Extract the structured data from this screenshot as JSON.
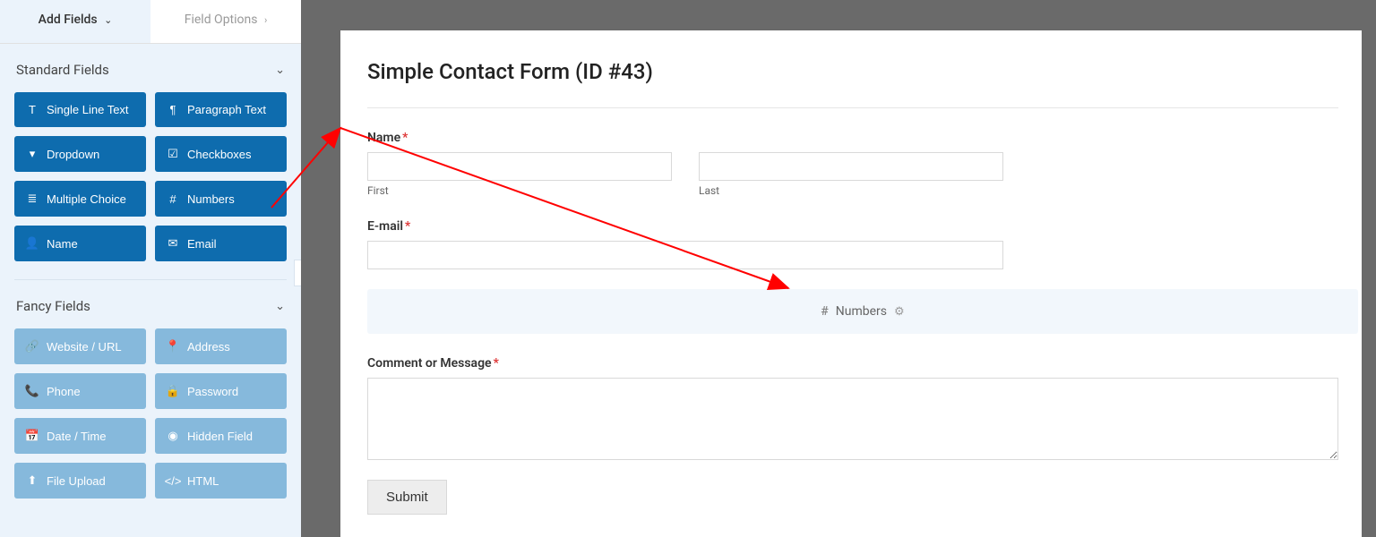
{
  "sidebar": {
    "tabs": {
      "add_fields": "Add Fields",
      "field_options": "Field Options"
    },
    "sections": {
      "standard": {
        "title": "Standard Fields",
        "fields": [
          {
            "icon": "text-icon",
            "glyph": "T",
            "label": "Single Line Text"
          },
          {
            "icon": "paragraph-icon",
            "glyph": "¶",
            "label": "Paragraph Text"
          },
          {
            "icon": "dropdown-icon",
            "glyph": "▾",
            "label": "Dropdown"
          },
          {
            "icon": "checkboxes-icon",
            "glyph": "☑",
            "label": "Checkboxes"
          },
          {
            "icon": "multiple-choice-icon",
            "glyph": "≣",
            "label": "Multiple Choice"
          },
          {
            "icon": "numbers-icon",
            "glyph": "#",
            "label": "Numbers"
          },
          {
            "icon": "name-icon",
            "glyph": "👤",
            "label": "Name"
          },
          {
            "icon": "email-icon",
            "glyph": "✉",
            "label": "Email"
          }
        ]
      },
      "fancy": {
        "title": "Fancy Fields",
        "fields": [
          {
            "icon": "website-icon",
            "glyph": "🔗",
            "label": "Website / URL"
          },
          {
            "icon": "address-icon",
            "glyph": "📍",
            "label": "Address"
          },
          {
            "icon": "phone-icon",
            "glyph": "📞",
            "label": "Phone"
          },
          {
            "icon": "password-icon",
            "glyph": "🔒",
            "label": "Password"
          },
          {
            "icon": "date-time-icon",
            "glyph": "📅",
            "label": "Date / Time"
          },
          {
            "icon": "hidden-field-icon",
            "glyph": "◉",
            "label": "Hidden Field"
          },
          {
            "icon": "file-upload-icon",
            "glyph": "⬆",
            "label": "File Upload"
          },
          {
            "icon": "html-icon",
            "glyph": "</>",
            "label": "HTML"
          }
        ]
      }
    }
  },
  "form": {
    "title": "Simple Contact Form (ID #43)",
    "name": {
      "label": "Name",
      "first_sub": "First",
      "last_sub": "Last"
    },
    "email": {
      "label": "E-mail"
    },
    "dropzone": {
      "icon_glyph": "#",
      "label": "Numbers"
    },
    "comment": {
      "label": "Comment or Message"
    },
    "submit": "Submit"
  }
}
